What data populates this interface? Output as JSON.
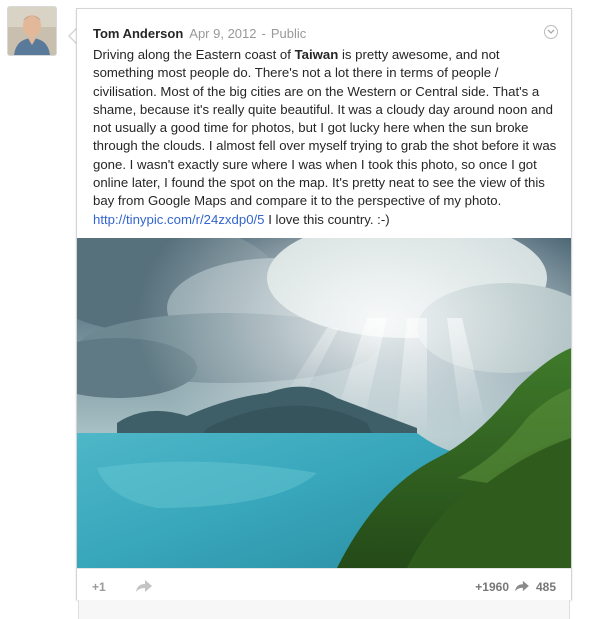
{
  "post": {
    "author": "Tom Anderson",
    "date": "Apr 9, 2012",
    "separator": "-",
    "visibility": "Public",
    "text": {
      "part1": "Driving along the Eastern coast of ",
      "bold": "Taiwan",
      "part2": " is pretty awesome, and not something most people do. There's not a lot there in terms of people / civilisation. Most of the big cities are on the Western or Central side. That's a shame, because it's really quite beautiful. It was a cloudy day around noon and not usually a good time for photos, but I got lucky here when the sun broke through the clouds. I almost fell over myself trying to grab the shot before it was gone. I wasn't exactly sure where I was when I took this photo, so once I got online later, I found the spot on the map. It's pretty neat to see the view of this bay from Google Maps and compare it to the perspective of my photo. ",
      "link": "http://tinypic.com/r/24zxdp0/5",
      "part3": " I love this country. :-)"
    }
  },
  "footer": {
    "plusone_label": "+1",
    "plus_count": "+1960",
    "share_count": "485"
  },
  "colors": {
    "link": "#3366cc",
    "meta": "#999999",
    "text": "#262626"
  },
  "icons": [
    "avatar-photo",
    "menu-chevron-icon",
    "share-arrow-icon"
  ]
}
